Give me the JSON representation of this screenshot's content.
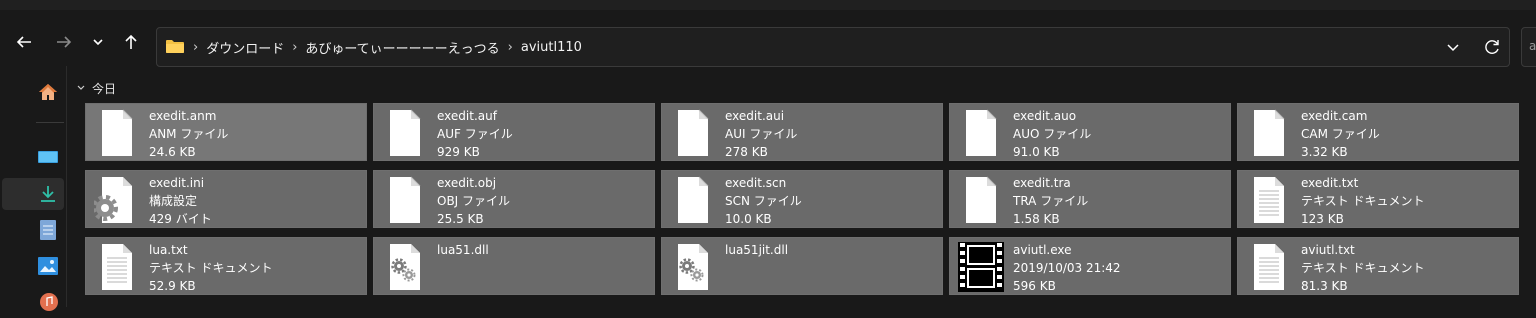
{
  "window": {
    "background": "#191919",
    "tile_color": "#6a6a6a"
  },
  "breadcrumb": [
    "ダウンロード",
    "あびゅーてぃーーーーーえっつる",
    "aviutl110"
  ],
  "search": {
    "placeholder": "a"
  },
  "sidebar": {
    "items": [
      {
        "icon": "home-icon"
      },
      {
        "icon": "desktop-icon"
      },
      {
        "icon": "download-icon",
        "selected": true
      },
      {
        "icon": "document-icon"
      },
      {
        "icon": "pictures-icon"
      },
      {
        "icon": "music-icon"
      }
    ]
  },
  "group": {
    "label": "今日"
  },
  "files": [
    {
      "name": "exedit.anm",
      "type": "ANM ファイル",
      "size": "24.6 KB",
      "icon": "blank-file-icon"
    },
    {
      "name": "exedit.auf",
      "type": "AUF ファイル",
      "size": "929 KB",
      "icon": "blank-file-icon"
    },
    {
      "name": "exedit.aui",
      "type": "AUI ファイル",
      "size": "278 KB",
      "icon": "blank-file-icon"
    },
    {
      "name": "exedit.auo",
      "type": "AUO ファイル",
      "size": "91.0 KB",
      "icon": "blank-file-icon"
    },
    {
      "name": "exedit.cam",
      "type": "CAM ファイル",
      "size": "3.32 KB",
      "icon": "blank-file-icon"
    },
    {
      "name": "exedit.ini",
      "type": "構成設定",
      "size": "429 バイト",
      "icon": "settings-file-icon"
    },
    {
      "name": "exedit.obj",
      "type": "OBJ ファイル",
      "size": "25.5 KB",
      "icon": "blank-file-icon"
    },
    {
      "name": "exedit.scn",
      "type": "SCN ファイル",
      "size": "10.0 KB",
      "icon": "blank-file-icon"
    },
    {
      "name": "exedit.tra",
      "type": "TRA ファイル",
      "size": "1.58 KB",
      "icon": "blank-file-icon"
    },
    {
      "name": "exedit.txt",
      "type": "テキスト ドキュメント",
      "size": "123 KB",
      "icon": "text-file-icon"
    },
    {
      "name": "lua.txt",
      "type": "テキスト ドキュメント",
      "size": "52.9 KB",
      "icon": "text-file-icon"
    },
    {
      "name": "lua51.dll",
      "type": "",
      "size": "",
      "icon": "dll-file-icon"
    },
    {
      "name": "lua51jit.dll",
      "type": "",
      "size": "",
      "icon": "dll-file-icon"
    },
    {
      "name": "aviutl.exe",
      "type": "2019/10/03 21:42",
      "size": "596 KB",
      "icon": "filmstrip-exe-icon"
    },
    {
      "name": "aviutl.txt",
      "type": "テキスト ドキュメント",
      "size": "81.3 KB",
      "icon": "text-file-icon"
    }
  ]
}
